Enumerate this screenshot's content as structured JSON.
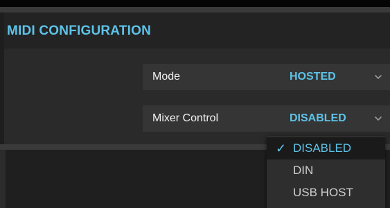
{
  "section": {
    "title": "MIDI CONFIGURATION"
  },
  "settings": [
    {
      "label": "Mode",
      "value": "HOSTED",
      "chevron_icon": "chevron-down-icon"
    },
    {
      "label": "Mixer Control",
      "value": "DISABLED",
      "chevron_icon": "chevron-down-icon"
    }
  ],
  "dropdown": {
    "check_mark": "✓",
    "options": [
      {
        "label": "DISABLED",
        "selected": true
      },
      {
        "label": "DIN",
        "selected": false
      },
      {
        "label": "USB HOST",
        "selected": false
      }
    ]
  },
  "colors": {
    "accent": "#5ec3e8",
    "background": "#242424",
    "row_background": "#353535",
    "text": "#f2f2f2"
  }
}
